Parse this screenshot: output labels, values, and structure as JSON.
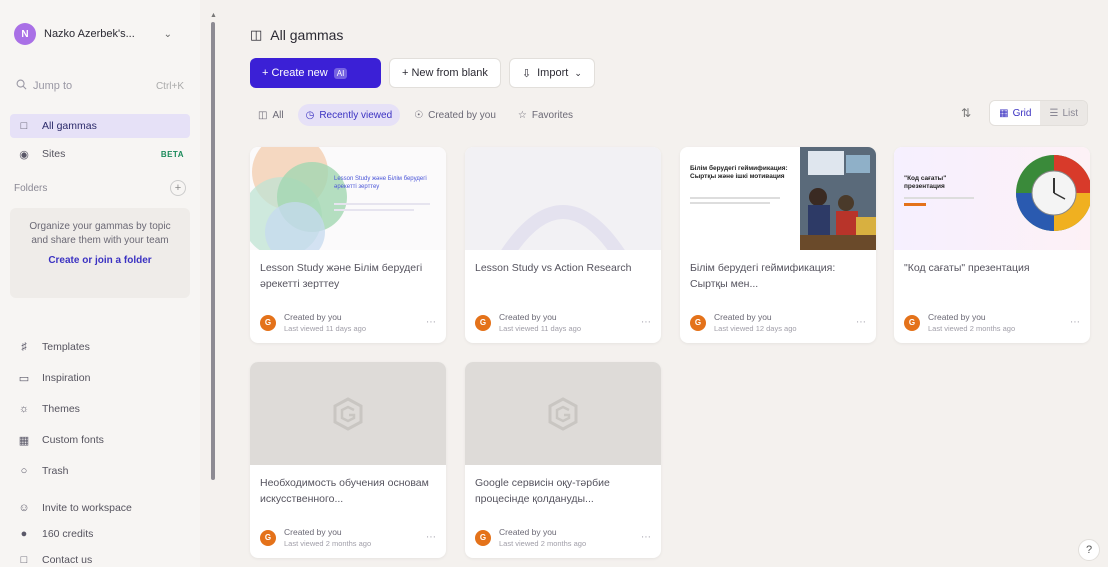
{
  "workspace": {
    "avatar": "N",
    "name": "Nazko Azerbek's...",
    "avatar_color": "#a970e6"
  },
  "search": {
    "placeholder": "Jump to",
    "shortcut": "Ctrl+K"
  },
  "nav": [
    {
      "label": "All gammas",
      "icon": "gallery-icon",
      "active": true
    },
    {
      "label": "Sites",
      "icon": "globe-icon",
      "badge": "BETA"
    }
  ],
  "folders": {
    "label": "Folders",
    "empty_text": "Organize your gammas by topic and share them with your team",
    "link": "Create or join a folder"
  },
  "nav2": [
    {
      "label": "Templates",
      "icon": "template-icon"
    },
    {
      "label": "Inspiration",
      "icon": "inspiration-icon"
    },
    {
      "label": "Themes",
      "icon": "themes-icon"
    },
    {
      "label": "Custom fonts",
      "icon": "fonts-icon"
    },
    {
      "label": "Trash",
      "icon": "trash-icon"
    }
  ],
  "nav3": [
    {
      "label": "Invite to workspace",
      "icon": "invite-icon"
    },
    {
      "label": "160 credits",
      "icon": "credits-icon"
    },
    {
      "label": "Contact us",
      "icon": "contact-icon"
    }
  ],
  "main": {
    "title": "All gammas",
    "create_label": "+ Create new",
    "create_badge": "AI",
    "blank_label": "+ New from blank",
    "import_label": "Import",
    "filters": [
      {
        "label": "All",
        "icon": "gallery-icon"
      },
      {
        "label": "Recently viewed",
        "icon": "clock-icon",
        "active": true
      },
      {
        "label": "Created by you",
        "icon": "user-icon"
      },
      {
        "label": "Favorites",
        "icon": "star-icon"
      }
    ],
    "view": {
      "grid": "Grid",
      "list": "List"
    }
  },
  "cards": [
    {
      "title": "Lesson Study және Білім берудегі әрекетті зерттеу",
      "by": "Created by you",
      "when": "Last viewed 11 days ago",
      "thumb": "venn",
      "thumb_text": "Lesson Study және Білім берудегі әрекетті зерттеу"
    },
    {
      "title": "Lesson Study vs Action Research",
      "by": "Created by you",
      "when": "Last viewed 11 days ago",
      "thumb": "light"
    },
    {
      "title": "Білім берудегі геймификация: Сыртқы мен...",
      "by": "Created by you",
      "when": "Last viewed 12 days ago",
      "thumb": "photo",
      "thumb_text": "Білім берудегі геймификация: Сыртқы және ішкі мотивация"
    },
    {
      "title": "\"Код сағаты\" презентация",
      "by": "Created by you",
      "when": "Last viewed 2 months ago",
      "thumb": "clock",
      "thumb_text": "\"Код сағаты\" презентация"
    },
    {
      "title": "Необходимость обучения основам искусственного...",
      "by": "Created by you",
      "when": "Last viewed 2 months ago",
      "thumb": "blank"
    },
    {
      "title": "Google сервисін оқу-тәрбие процесінде қолдануды...",
      "by": "Created by you",
      "when": "Last viewed 2 months ago",
      "thumb": "blank"
    }
  ],
  "colors": {
    "accent": "#3b20d6",
    "avatar_orange": "#e4721a",
    "active_bg": "#e6e1f7"
  },
  "help": "?"
}
